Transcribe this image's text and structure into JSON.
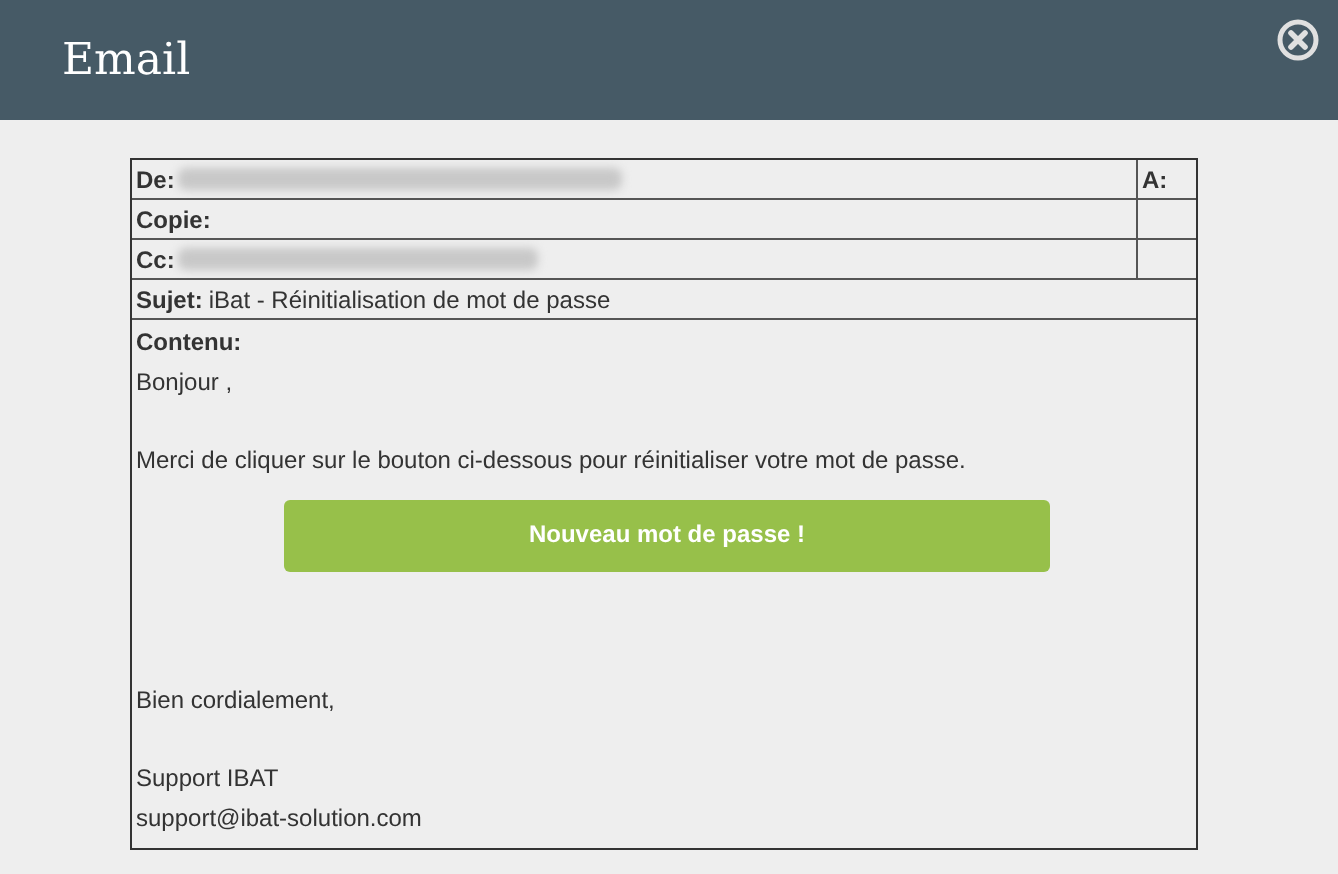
{
  "window": {
    "title": "Email"
  },
  "header_rows": [
    {
      "label": "De:",
      "redacted": true,
      "side_label": "A:"
    },
    {
      "label": "Copie:",
      "redacted": false
    },
    {
      "label": "Cc:",
      "redacted": true
    }
  ],
  "subject": {
    "label": "Sujet:",
    "value": "iBat - Réinitialisation de mot de passe"
  },
  "content": {
    "label": "Contenu:",
    "greeting": "Bonjour ,",
    "message": "Merci de cliquer sur le bouton ci-dessous pour réinitialiser votre mot de passe.",
    "button": "Nouveau mot de passe !",
    "closing": "Bien cordialement,",
    "signature": [
      "Support IBAT",
      "support@ibat-solution.com"
    ]
  }
}
